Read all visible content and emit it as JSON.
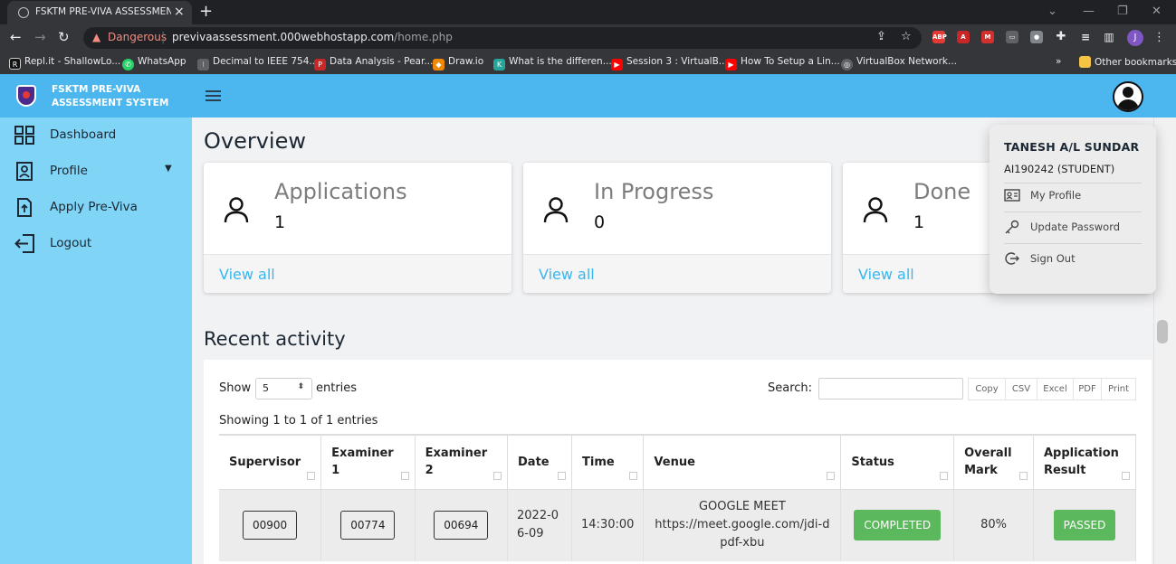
{
  "browser": {
    "tab_title": "FSKTM PRE-VIVA ASSESSMENT S",
    "security_label": "Dangerous",
    "url_host": "previvaassessment.000webhostapp.com",
    "url_path": "/home.php",
    "profile_initial": "J",
    "bookmarks": [
      {
        "label": "Repl.it - ShallowLo..."
      },
      {
        "label": "WhatsApp"
      },
      {
        "label": "Decimal to IEEE 754..."
      },
      {
        "label": "Data Analysis - Pear..."
      },
      {
        "label": "Draw.io"
      },
      {
        "label": "What is the differen..."
      },
      {
        "label": "Session 3 : VirtualB..."
      },
      {
        "label": "How To Setup a Lin..."
      },
      {
        "label": "VirtualBox Network..."
      }
    ],
    "overflow": "»",
    "other_bookmarks": "Other bookmarks"
  },
  "app": {
    "brand_line1": "FSKTM PRE-VIVA",
    "brand_line2": "ASSESSMENT SYSTEM"
  },
  "sidebar": {
    "items": [
      {
        "label": "Dashboard"
      },
      {
        "label": "Profile"
      },
      {
        "label": "Apply Pre-Viva"
      },
      {
        "label": "Logout"
      }
    ]
  },
  "overview": {
    "title": "Overview",
    "cards": [
      {
        "title": "Applications",
        "value": "1",
        "link": "View all"
      },
      {
        "title": "In Progress",
        "value": "0",
        "link": "View all"
      },
      {
        "title": "Done",
        "value": "1",
        "link": "View all"
      }
    ]
  },
  "recent": {
    "title": "Recent activity",
    "show_label": "Show",
    "page_length": "5",
    "entries_label": "entries",
    "search_label": "Search:",
    "search_value": "",
    "export_buttons": [
      "Copy",
      "CSV",
      "Excel",
      "PDF",
      "Print"
    ],
    "info": "Showing 1 to 1 of 1 entries",
    "columns": [
      "Supervisor",
      "Examiner 1",
      "Examiner 2",
      "Date",
      "Time",
      "Venue",
      "Status",
      "Overall Mark",
      "Application Result"
    ],
    "rows": [
      {
        "supervisor": "00900",
        "examiner1": "00774",
        "examiner2": "00694",
        "date": "2022-06-09",
        "time": "14:30:00",
        "venue_line1": "GOOGLE MEET",
        "venue_line2": "https://meet.google.com/jdi-dpdf-xbu",
        "status": "COMPLETED",
        "mark": "80%",
        "result": "PASSED"
      }
    ]
  },
  "user_menu": {
    "name": "TANESH A/L SUNDAR",
    "id_role": "AI190242 (STUDENT)",
    "items": [
      {
        "label": "My Profile",
        "icon": "id-card-icon"
      },
      {
        "label": "Update Password",
        "icon": "key-icon"
      },
      {
        "label": "Sign Out",
        "icon": "sign-out-icon"
      }
    ]
  },
  "colors": {
    "header": "#4cb7ee",
    "sidebar": "#80d4f6",
    "link": "#38b6ee",
    "success": "#5cb85c"
  }
}
